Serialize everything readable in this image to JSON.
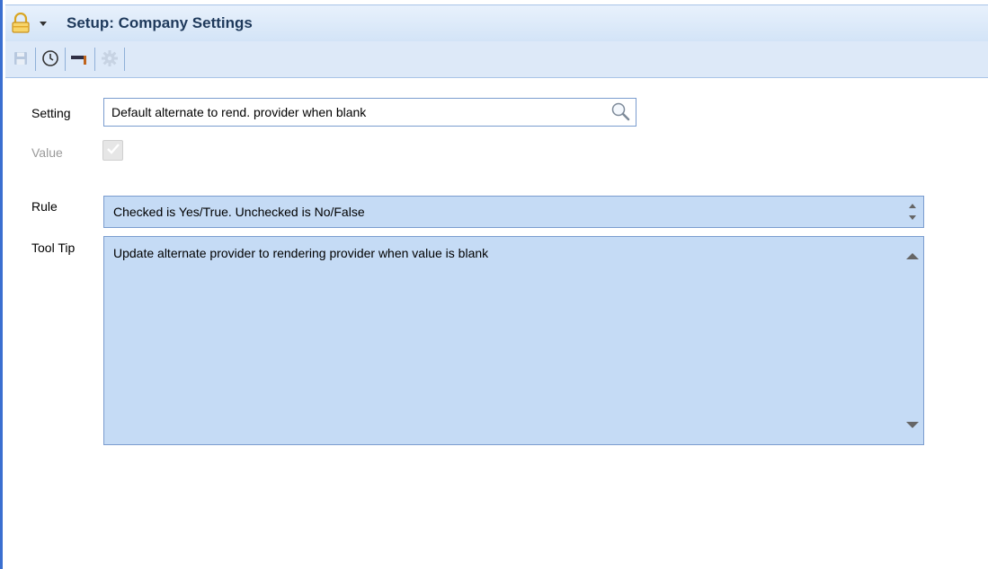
{
  "window": {
    "title": "Setup: Company Settings",
    "lock_icon": "lock-icon",
    "menu_caret_icon": "caret-down-icon"
  },
  "toolbar": {
    "buttons": [
      {
        "name": "save-button",
        "icon": "save-icon",
        "enabled": false
      },
      {
        "name": "history-button",
        "icon": "clock-icon",
        "enabled": true
      },
      {
        "name": "permissions-button",
        "icon": "gavel-icon",
        "enabled": true
      },
      {
        "name": "settings-button",
        "icon": "gear-icon",
        "enabled": false
      }
    ]
  },
  "form": {
    "setting_label": "Setting",
    "setting_value": "Default alternate to rend. provider when blank",
    "search_icon": "search-icon",
    "value_label": "Value",
    "value_checked": true,
    "rule_label": "Rule",
    "rule_value": "Checked is Yes/True. Unchecked is No/False",
    "tooltip_label": "Tool Tip",
    "tooltip_value": "Update alternate provider to rendering provider when value is blank"
  },
  "colors": {
    "accent": "#3a6fd0",
    "field_fill": "#c5dbf5",
    "field_border": "#7a9ccf",
    "title_text": "#1e395b"
  }
}
